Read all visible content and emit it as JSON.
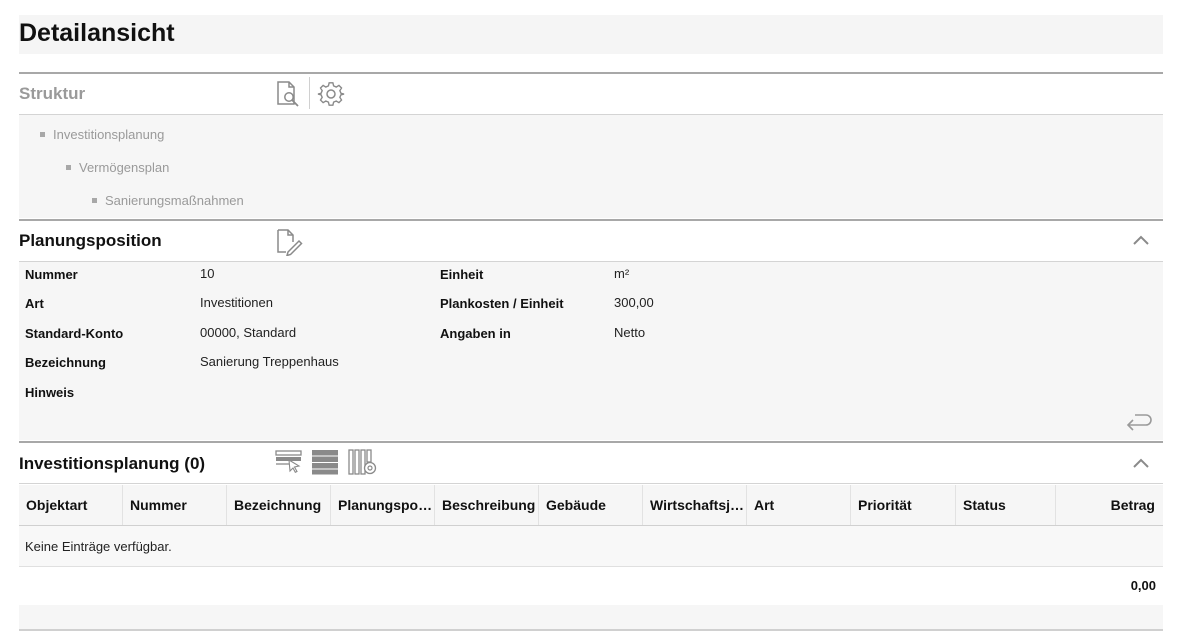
{
  "page": {
    "title": "Detailansicht"
  },
  "struktur": {
    "title": "Struktur",
    "tree": [
      "Investitionsplanung",
      "Vermögensplan",
      "Sanierungsmaßnahmen"
    ]
  },
  "planungsposition": {
    "title": "Planungsposition",
    "left_fields": [
      {
        "label": "Nummer",
        "value": "10"
      },
      {
        "label": "Art",
        "value": "Investitionen"
      },
      {
        "label": "Standard-Konto",
        "value": "00000, Standard"
      },
      {
        "label": "Bezeichnung",
        "value": "Sanierung Treppenhaus"
      },
      {
        "label": "Hinweis",
        "value": ""
      }
    ],
    "right_fields": [
      {
        "label": "Einheit",
        "value": "m²"
      },
      {
        "label": "Plankosten / Einheit",
        "value": "300,00"
      },
      {
        "label": "Angaben in",
        "value": "Netto"
      }
    ]
  },
  "investitionsplanung": {
    "title": "Investitionsplanung (0)",
    "columns": [
      "Objektart",
      "Nummer",
      "Bezeichnung",
      "Planungspos...",
      "Beschreibung",
      "Gebäude",
      "Wirtschaftsjahr",
      "Art",
      "Priorität",
      "Status",
      "Betrag"
    ],
    "empty_text": "Keine Einträge verfügbar.",
    "total": "0,00"
  },
  "icons": {
    "preview": "document-search-icon",
    "settings": "gear-icon",
    "edit": "document-edit-icon",
    "collapse": "chevron-up-icon",
    "back": "return-arrow-icon",
    "select_rows": "select-rows-icon",
    "list_view": "list-view-icon",
    "column_settings": "column-settings-icon"
  }
}
